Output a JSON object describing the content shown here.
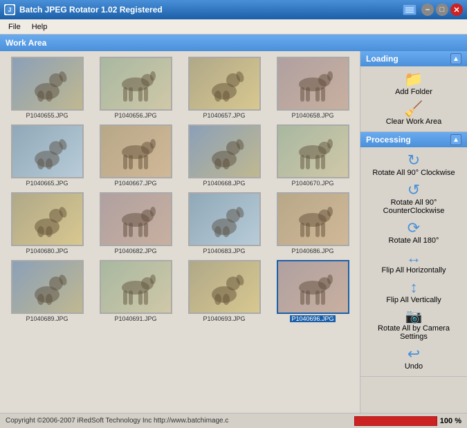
{
  "titleBar": {
    "title": "Batch JPEG Rotator 1.02 Registered",
    "icon": "B"
  },
  "menuBar": {
    "items": [
      {
        "label": "File"
      },
      {
        "label": "Help"
      }
    ]
  },
  "workArea": {
    "header": "Work Area"
  },
  "images": [
    {
      "id": 1,
      "filename": "P1040655.JPG",
      "selected": false,
      "bg": 1
    },
    {
      "id": 2,
      "filename": "P1040656.JPG",
      "selected": false,
      "bg": 2
    },
    {
      "id": 3,
      "filename": "P1040657.JPG",
      "selected": false,
      "bg": 3
    },
    {
      "id": 4,
      "filename": "P1040658.JPG",
      "selected": false,
      "bg": 4
    },
    {
      "id": 5,
      "filename": "P1040665.JPG",
      "selected": false,
      "bg": 5
    },
    {
      "id": 6,
      "filename": "P1040667.JPG",
      "selected": false,
      "bg": 6
    },
    {
      "id": 7,
      "filename": "P1040668.JPG",
      "selected": false,
      "bg": 1
    },
    {
      "id": 8,
      "filename": "P1040670.JPG",
      "selected": false,
      "bg": 2
    },
    {
      "id": 9,
      "filename": "P1040680.JPG",
      "selected": false,
      "bg": 3
    },
    {
      "id": 10,
      "filename": "P1040682.JPG",
      "selected": false,
      "bg": 4
    },
    {
      "id": 11,
      "filename": "P1040683.JPG",
      "selected": false,
      "bg": 5
    },
    {
      "id": 12,
      "filename": "P1040686.JPG",
      "selected": false,
      "bg": 6
    },
    {
      "id": 13,
      "filename": "P1040689.JPG",
      "selected": false,
      "bg": 1
    },
    {
      "id": 14,
      "filename": "P1040691.JPG",
      "selected": false,
      "bg": 2
    },
    {
      "id": 15,
      "filename": "P1040693.JPG",
      "selected": false,
      "bg": 3
    },
    {
      "id": 16,
      "filename": "P1040696.JPG",
      "selected": true,
      "bg": 4
    }
  ],
  "rightPanel": {
    "loading": {
      "header": "Loading",
      "addFolderLabel": "Add Folder",
      "clearLabel": "Clear Work Area"
    },
    "processing": {
      "header": "Processing",
      "actions": [
        {
          "id": "rotate-cw",
          "label": "Rotate All 90° Clockwise",
          "iconClass": "icon-rotate-cw"
        },
        {
          "id": "rotate-ccw",
          "label": "Rotate All 90° CounterClockwise",
          "iconClass": "icon-rotate-ccw"
        },
        {
          "id": "rotate-180",
          "label": "Rotate All 180°",
          "iconClass": "icon-rotate-180"
        },
        {
          "id": "flip-h",
          "label": "Flip All Horizontally",
          "iconClass": "icon-flip-h"
        },
        {
          "id": "flip-v",
          "label": "Flip All Vertically",
          "iconClass": "icon-flip-v"
        },
        {
          "id": "rotate-camera",
          "label": "Rotate All by Camera Settings",
          "iconClass": "icon-camera"
        },
        {
          "id": "undo",
          "label": "Undo",
          "iconClass": "icon-undo"
        }
      ]
    }
  },
  "statusBar": {
    "copyright": "Copyright ©2006-2007 iRedSoft Technology Inc http://www.batchimage.c",
    "progressPercent": 100,
    "progressLabel": "100 %"
  }
}
